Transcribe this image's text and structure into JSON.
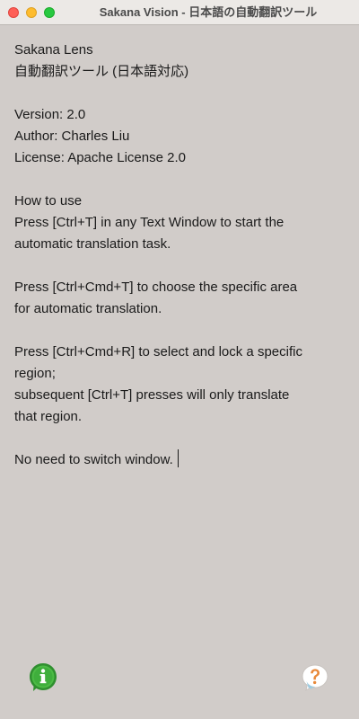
{
  "window": {
    "title": "Sakana Vision - 日本語の自動翻訳ツール"
  },
  "content": {
    "app_name": "Sakana Lens",
    "subtitle": "自動翻訳ツール (日本語対応)",
    "version": "Version: 2.0",
    "author": "Author: Charles Liu",
    "license": "License: Apache License 2.0",
    "howto_heading": "How to use",
    "instruction_1_line_1": "Press [Ctrl+T] in any Text Window to start the",
    "instruction_1_line_2": "automatic translation task.",
    "instruction_2_line_1": "Press [Ctrl+Cmd+T] to choose the specific area",
    "instruction_2_line_2": "for automatic translation.",
    "instruction_3_line_1": "Press [Ctrl+Cmd+R] to select and lock a specific",
    "instruction_3_line_2": "region;",
    "instruction_3_line_3": "subsequent [Ctrl+T] presses will only translate",
    "instruction_3_line_4": "that region.",
    "footer_note": "No need to switch window."
  },
  "icons": {
    "info": "info-icon",
    "help": "help-icon"
  },
  "colors": {
    "background": "#d1ccc9",
    "info_icon_green": "#3fae3c",
    "help_icon_orange": "#e8893a"
  }
}
